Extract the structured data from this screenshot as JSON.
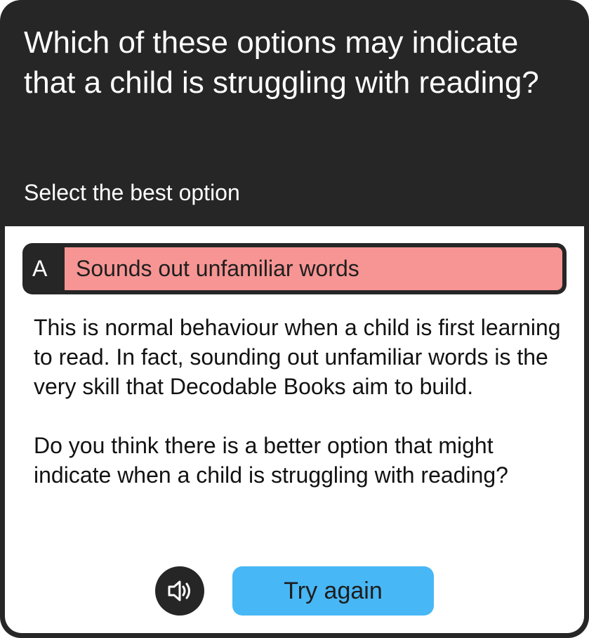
{
  "question": {
    "text": "Which of these options may indicate that a child is struggling with reading?",
    "instruction": "Select the best option"
  },
  "option": {
    "letter": "A",
    "text": "Sounds out unfamiliar words",
    "highlight_color": "#f69593"
  },
  "feedback": {
    "paragraph_1": "This is normal behaviour when a child is first learning to read. In fact, sounding out unfamiliar words is the very skill that Decodable Books aim to build.",
    "paragraph_2": "Do you think there is a better option that might indicate when a child is struggling with reading?"
  },
  "actions": {
    "audio_icon": "speaker-icon",
    "try_again_label": "Try again",
    "try_again_color": "#48b7f5"
  },
  "colors": {
    "frame": "#262626",
    "panel": "#ffffff"
  }
}
